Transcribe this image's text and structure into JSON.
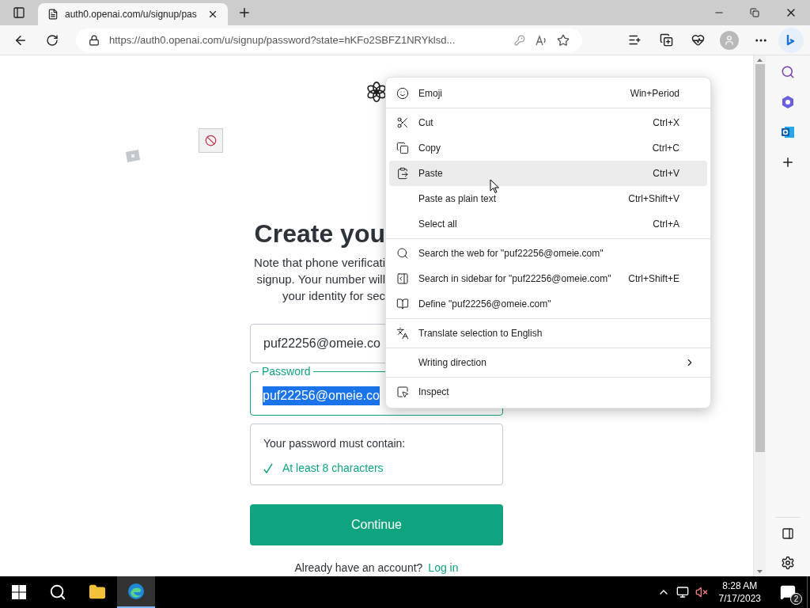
{
  "browser": {
    "tab": {
      "title": "auth0.openai.com/u/signup/pas",
      "selected": true
    },
    "address": "https://auth0.openai.com/u/signup/password?state=hKFo2SBFZ1NRYklsd..."
  },
  "page": {
    "heading": "Create you",
    "note_lines": [
      "Note that phone verificati",
      "signup. Your number will",
      "your identity for sec"
    ],
    "email": {
      "value": "puf22256@omeie.co"
    },
    "password": {
      "label": "Password",
      "value": "puf22256@omeie.co",
      "selected_text": true
    },
    "requirements": {
      "title": "Your password must contain:",
      "items": [
        {
          "text": "At least 8 characters",
          "checked": true
        }
      ]
    },
    "continue": "Continue",
    "login_prompt": "Already have an account?",
    "login_link": "Log in"
  },
  "context_menu": {
    "groups": [
      [
        {
          "label": "Emoji",
          "shortcut": "Win+Period",
          "selected": false
        }
      ],
      [
        {
          "label": "Cut",
          "shortcut": "Ctrl+X",
          "selected": false
        },
        {
          "label": "Copy",
          "shortcut": "Ctrl+C",
          "selected": false
        },
        {
          "label": "Paste",
          "shortcut": "Ctrl+V",
          "selected": true
        },
        {
          "label": "Paste as plain text",
          "shortcut": "Ctrl+Shift+V",
          "selected": false
        },
        {
          "label": "Select all",
          "shortcut": "Ctrl+A",
          "selected": false
        }
      ],
      [
        {
          "label": "Search the web for \"puf22256@omeie.com\"",
          "selected": false
        },
        {
          "label": "Search in sidebar for \"puf22256@omeie.com\"",
          "shortcut": "Ctrl+Shift+E",
          "selected": false
        },
        {
          "label": "Define \"puf22256@omeie.com\"",
          "selected": false
        }
      ],
      [
        {
          "label": "Translate selection to English",
          "selected": false
        }
      ],
      [
        {
          "label": "Writing direction",
          "submenu": true,
          "selected": false
        }
      ],
      [
        {
          "label": "Inspect",
          "selected": false
        }
      ]
    ]
  },
  "taskbar": {
    "time": "8:28 AM",
    "date": "7/17/2023",
    "notifications": "2"
  }
}
